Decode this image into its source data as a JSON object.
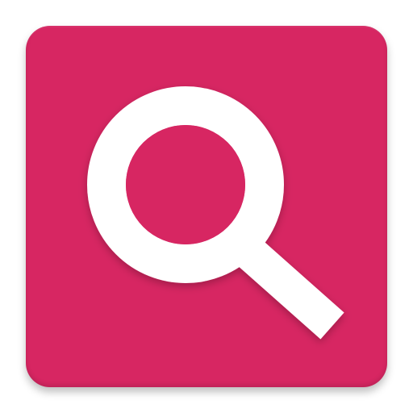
{
  "app_icon": {
    "icon_name": "search-icon",
    "colors": {
      "tile_background": "#d72662",
      "glyph": "#ffffff",
      "page_background": "#ffffff"
    }
  }
}
